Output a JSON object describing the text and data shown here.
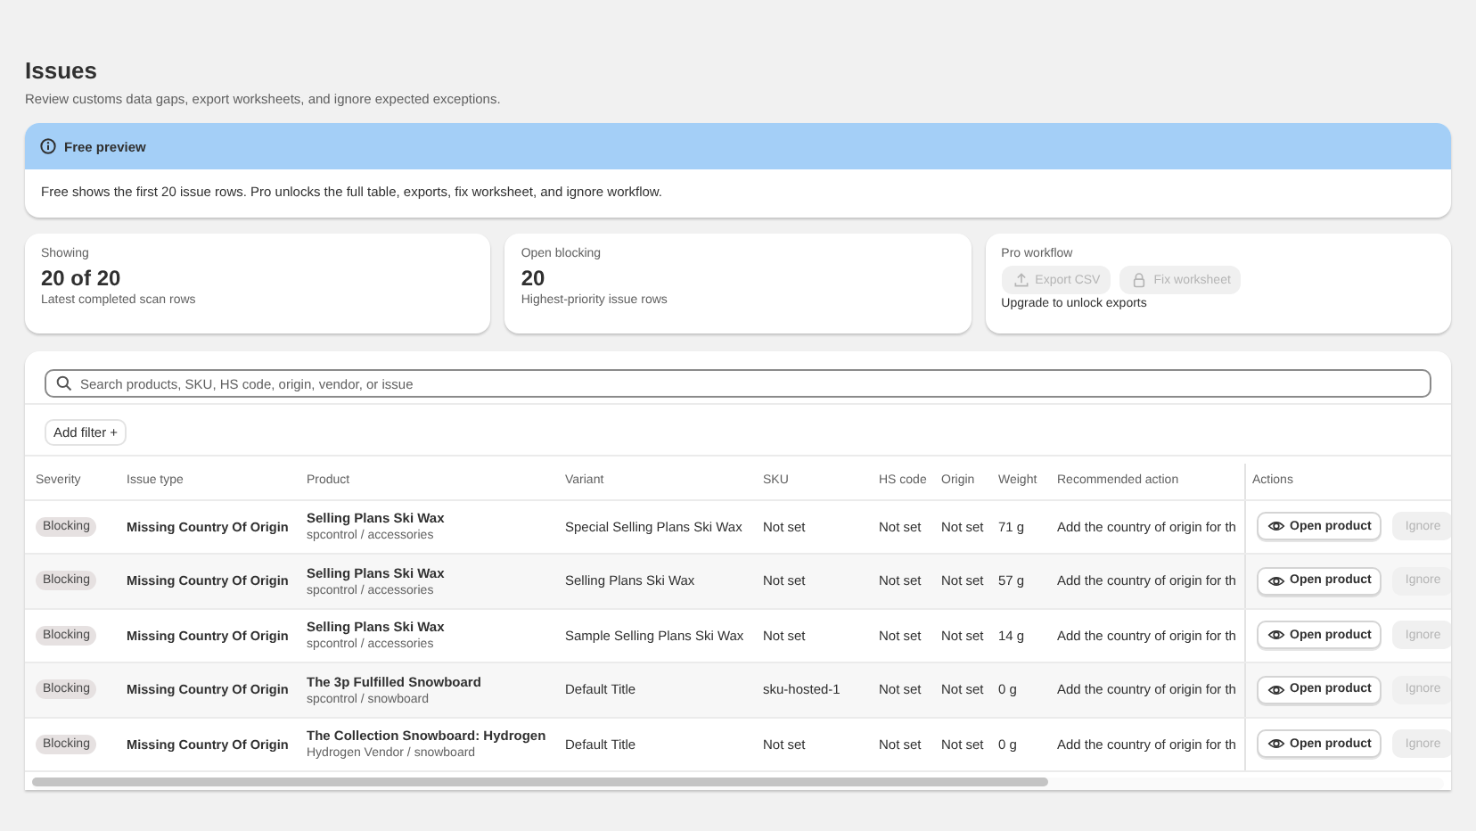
{
  "page": {
    "title": "Issues",
    "subtitle": "Review customs data gaps, export worksheets, and ignore expected exceptions."
  },
  "banner": {
    "title": "Free preview",
    "text": "Free shows the first 20 issue rows. Pro unlocks the full table, exports, fix worksheet, and ignore workflow."
  },
  "stats": [
    {
      "kind": "metric",
      "label": "Showing",
      "value": "20 of 20",
      "note": "Latest completed scan rows"
    },
    {
      "kind": "metric",
      "label": "Open blocking",
      "value": "20",
      "note": "Highest-priority issue rows"
    },
    {
      "kind": "actions",
      "label": "Pro workflow",
      "buttons": [
        {
          "label": "Export CSV",
          "disabled": true
        },
        {
          "label": "Fix worksheet",
          "disabled": true
        }
      ],
      "note": "Upgrade to unlock exports"
    }
  ],
  "search": {
    "placeholder": "Search products, SKU, HS code, origin, vendor, or issue"
  },
  "add_filter": "Add filter +",
  "table": {
    "columns": [
      "Severity",
      "Issue type",
      "Product",
      "Variant",
      "SKU",
      "HS code",
      "Origin",
      "Weight",
      "Recommended action",
      "Actions"
    ],
    "rows": [
      {
        "severity": "Blocking",
        "issue": "Missing Country Of Origin",
        "product": "Selling Plans Ski Wax",
        "vendor": "spcontrol / accessories",
        "variant": "Special Selling Plans Ski Wax",
        "sku": "Not set",
        "hs_code": "Not set",
        "origin": "Not set",
        "weight": "71 g",
        "action": "Add the country of origin for th",
        "open": "Open product",
        "ignore": {
          "label": "Ignore",
          "disabled": true
        }
      },
      {
        "severity": "Blocking",
        "issue": "Missing Country Of Origin",
        "product": "Selling Plans Ski Wax",
        "vendor": "spcontrol / accessories",
        "variant": "Selling Plans Ski Wax",
        "sku": "Not set",
        "hs_code": "Not set",
        "origin": "Not set",
        "weight": "57 g",
        "action": "Add the country of origin for th",
        "open": "Open product",
        "ignore": {
          "label": "Ignore",
          "disabled": true
        }
      },
      {
        "severity": "Blocking",
        "issue": "Missing Country Of Origin",
        "product": "Selling Plans Ski Wax",
        "vendor": "spcontrol / accessories",
        "variant": "Sample Selling Plans Ski Wax",
        "sku": "Not set",
        "hs_code": "Not set",
        "origin": "Not set",
        "weight": "14 g",
        "action": "Add the country of origin for th",
        "open": "Open product",
        "ignore": {
          "label": "Ignore",
          "disabled": true
        }
      },
      {
        "severity": "Blocking",
        "issue": "Missing Country Of Origin",
        "product": "The 3p Fulfilled Snowboard",
        "vendor": "spcontrol / snowboard",
        "variant": "Default Title",
        "sku": "sku-hosted-1",
        "hs_code": "Not set",
        "origin": "Not set",
        "weight": "0 g",
        "action": "Add the country of origin for th",
        "open": "Open product",
        "ignore": {
          "label": "Ignore",
          "disabled": true
        }
      },
      {
        "severity": "Blocking",
        "issue": "Missing Country Of Origin",
        "product": "The Collection Snowboard: Hydrogen",
        "vendor": "Hydrogen Vendor / snowboard",
        "variant": "Default Title",
        "sku": "Not set",
        "hs_code": "Not set",
        "origin": "Not set",
        "weight": "0 g",
        "action": "Add the country of origin for th",
        "open": "Open product",
        "ignore": {
          "label": "Ignore",
          "disabled": true
        }
      }
    ]
  }
}
